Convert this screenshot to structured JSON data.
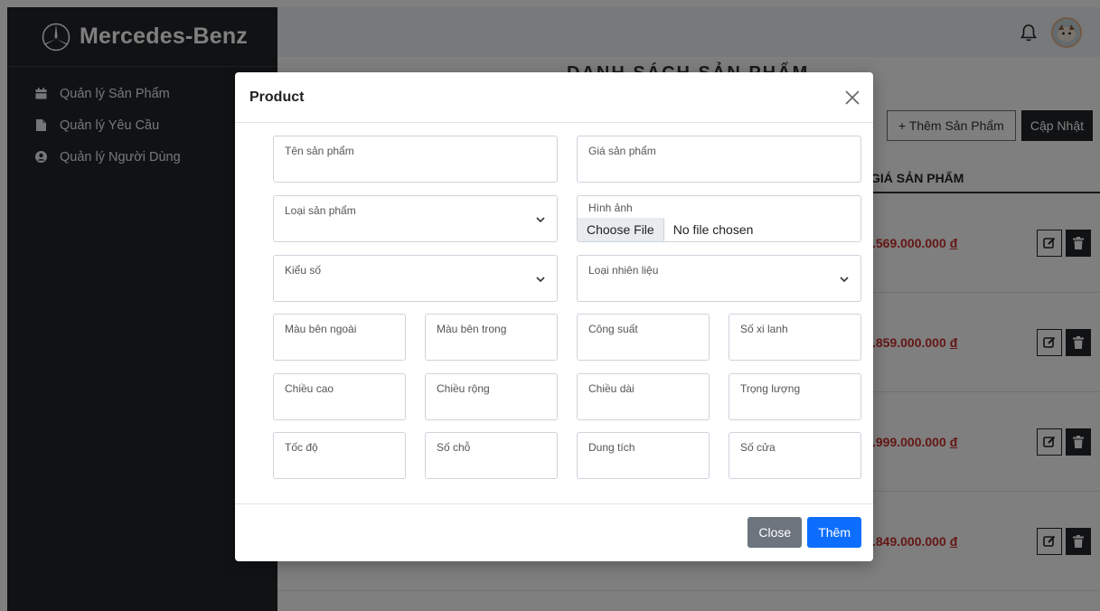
{
  "sidebar": {
    "brand": "Mercedes-Benz",
    "items": [
      {
        "label": "Quản lý Sản Phẩm",
        "icon": "calendar-icon"
      },
      {
        "label": "Quản lý Yêu Cầu",
        "icon": "file-icon"
      },
      {
        "label": "Quản lý Người Dùng",
        "icon": "user-circle-icon"
      }
    ]
  },
  "main": {
    "page_title": "DANH SÁCH SẢN PHẨM",
    "add_label": "+ Thêm Sản Phẩm",
    "update_label": "Cập Nhật",
    "table": {
      "price_header": "GIÁ SẢN PHẨM",
      "rows": [
        {
          "price": ".569.000.000",
          "currency": "đ"
        },
        {
          "price": ".859.000.000",
          "currency": "đ"
        },
        {
          "price": ".999.000.000",
          "currency": "đ"
        },
        {
          "price": ".849.000.000",
          "currency": "đ"
        }
      ]
    }
  },
  "modal": {
    "title": "Product",
    "fields": {
      "name": "Tên sản phẩm",
      "price": "Giá sản phẩm",
      "type": "Loại sản phẩm",
      "image": "Hình ảnh",
      "file_button": "Choose File",
      "file_status": "No file chosen",
      "transmission": "Kiểu số",
      "fuel": "Loại nhiên liệu",
      "ext_color": "Màu bên ngoài",
      "int_color": "Màu bên trong",
      "power": "Công suất",
      "cylinders": "Số xi lanh",
      "height": "Chiều cao",
      "width": "Chiều rộng",
      "length": "Chiều dài",
      "weight": "Trọng lượng",
      "speed": "Tốc độ",
      "seats": "Số chỗ",
      "capacity": "Dung tích",
      "doors": "Số cửa"
    },
    "close_label": "Close",
    "submit_label": "Thêm"
  },
  "colors": {
    "sidebar_bg": "#212529",
    "price_red": "#c9302c",
    "primary": "#0d6efd",
    "secondary": "#6c757d"
  }
}
